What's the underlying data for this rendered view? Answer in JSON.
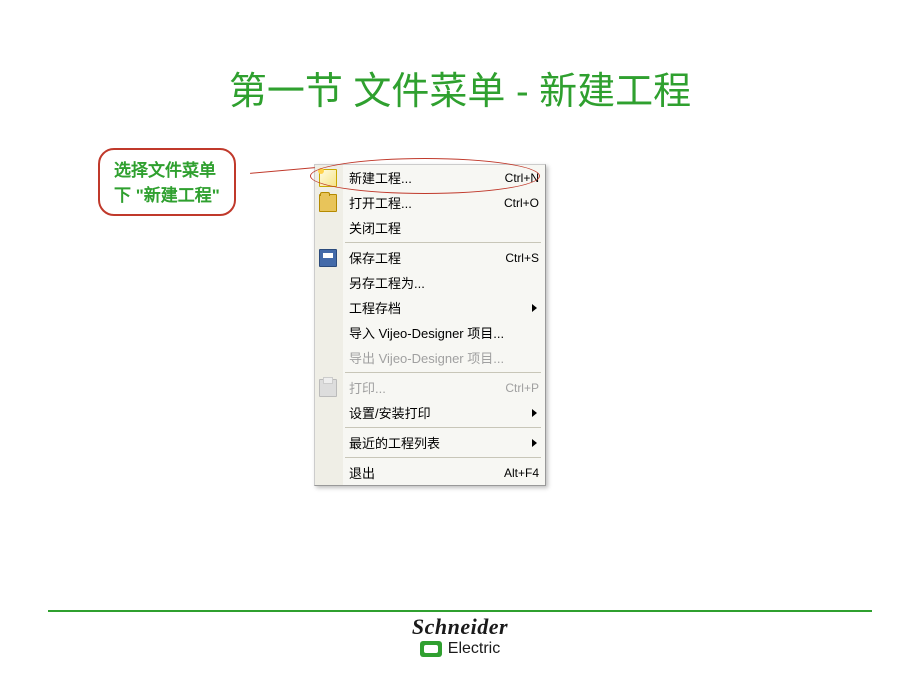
{
  "title": "第一节 文件菜单 - 新建工程",
  "callout": {
    "line1": "选择文件菜单",
    "line2": "下 \"新建工程\""
  },
  "menu": {
    "items": [
      {
        "label": "新建工程...",
        "shortcut": "Ctrl+N",
        "icon": "new",
        "disabled": false,
        "submenu": false
      },
      {
        "label": "打开工程...",
        "shortcut": "Ctrl+O",
        "icon": "open",
        "disabled": false,
        "submenu": false
      },
      {
        "label": "关闭工程",
        "shortcut": "",
        "icon": "",
        "disabled": false,
        "submenu": false
      },
      {
        "sep": true
      },
      {
        "label": "保存工程",
        "shortcut": "Ctrl+S",
        "icon": "save",
        "disabled": false,
        "submenu": false
      },
      {
        "label": "另存工程为...",
        "shortcut": "",
        "icon": "",
        "disabled": false,
        "submenu": false
      },
      {
        "label": "工程存档",
        "shortcut": "",
        "icon": "",
        "disabled": false,
        "submenu": true
      },
      {
        "label": "导入 Vijeo-Designer 项目...",
        "shortcut": "",
        "icon": "",
        "disabled": false,
        "submenu": false
      },
      {
        "label": "导出 Vijeo-Designer 项目...",
        "shortcut": "",
        "icon": "",
        "disabled": true,
        "submenu": false
      },
      {
        "sep": true
      },
      {
        "label": "打印...",
        "shortcut": "Ctrl+P",
        "icon": "print",
        "disabled": true,
        "submenu": false
      },
      {
        "label": "设置/安装打印",
        "shortcut": "",
        "icon": "",
        "disabled": false,
        "submenu": true
      },
      {
        "sep": true
      },
      {
        "label": "最近的工程列表",
        "shortcut": "",
        "icon": "",
        "disabled": false,
        "submenu": true
      },
      {
        "sep": true
      },
      {
        "label": "退出",
        "shortcut": "Alt+F4",
        "icon": "",
        "disabled": false,
        "submenu": false
      }
    ]
  },
  "brand": {
    "name1": "Schneider",
    "name2": "Electric"
  }
}
